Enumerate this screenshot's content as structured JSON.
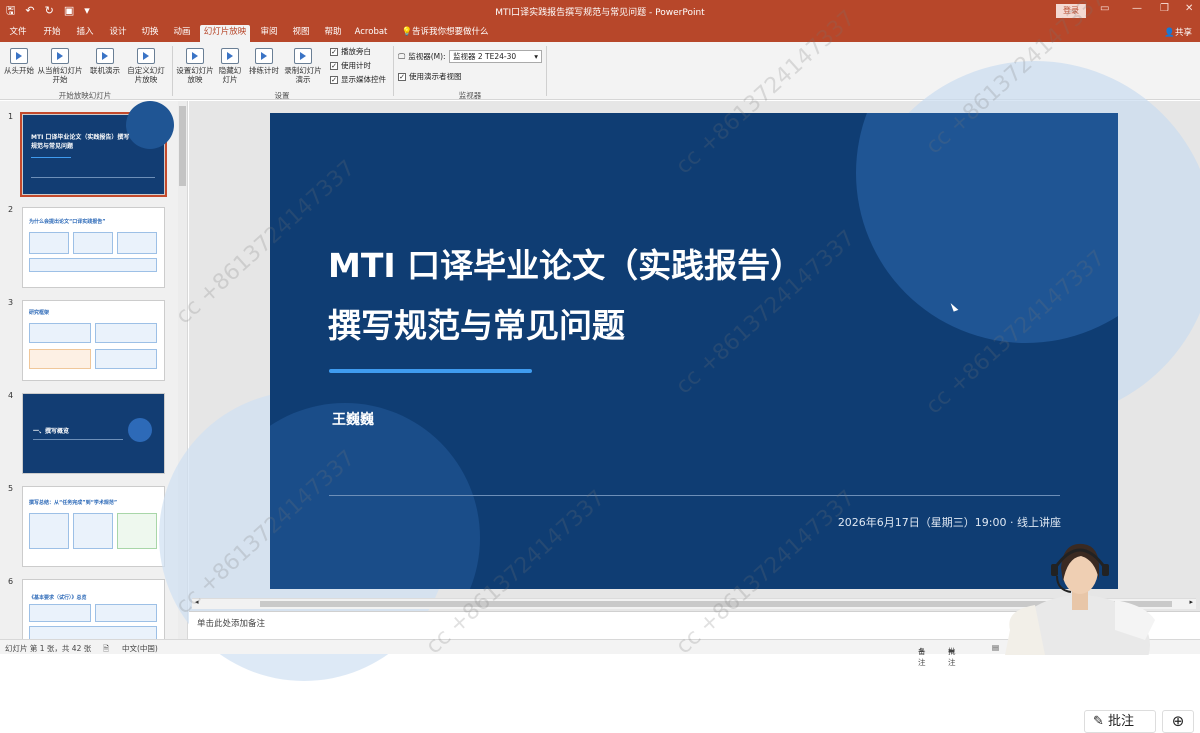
{
  "titlebar": {
    "title": "MTI口译实践报告撰写规范与常见问题 - PowerPoint",
    "login": "登录",
    "colors": {
      "bar": "#b7472a"
    }
  },
  "tabs": [
    "文件",
    "开始",
    "插入",
    "设计",
    "切换",
    "动画",
    "幻灯片放映",
    "审阅",
    "视图",
    "帮助",
    "Acrobat"
  ],
  "active_tab": "幻灯片放映",
  "tell_me": "告诉我你想要做什么",
  "share": "共享",
  "ribbon": {
    "btn_from_start": "从头开始",
    "btn_from_current": "从当前幻灯片开始",
    "btn_online": "联机演示",
    "btn_custom": "自定义幻灯片放映",
    "group_start": "开始放映幻灯片",
    "btn_setup": "设置幻灯片放映",
    "btn_hide": "隐藏幻灯片",
    "btn_rehearse": "排练计时",
    "btn_record": "录制幻灯片演示",
    "chk_narration": "播放旁白",
    "chk_timing": "使用计时",
    "chk_media": "显示媒体控件",
    "group_setup": "设置",
    "monitor_label": "监视器(M):",
    "monitor_value": "监视器 2  TE24-30",
    "chk_presenter": "使用演示者视图",
    "group_monitor": "监视器"
  },
  "thumbnails": {
    "numbers": [
      "1",
      "2",
      "3",
      "4",
      "5",
      "6"
    ],
    "t1_title": "MTI 口译毕业论文（实践报告）撰写规范与常见问题",
    "t2_title": "为什么会提出论文“口译实践报告”",
    "t3_title": "研究框架",
    "t4_title": "一、撰写概览",
    "t5_title": "撰写总结：从“任务完成”到“学术规范”",
    "t6_title": "《基本要求（试行）》总览"
  },
  "slide": {
    "title_line1": "MTI 口译毕业论文（实践报告）",
    "title_line2": "撰写规范与常见问题",
    "author": "王巍巍",
    "date_line": "2026年6月17日（星期三）19:00  ·  线上讲座",
    "colors": {
      "bg": "#0f3d73",
      "accent": "#3f9cf0"
    }
  },
  "notes_placeholder": "单击此处添加备注",
  "status": {
    "slide_count": "幻灯片 第 1 张，共 42 张",
    "language": "中文(中国)",
    "notes": "备注",
    "comments": "批注"
  },
  "floating": {
    "comment_btn": "批注",
    "zoom_icon": "zoom-in-icon"
  },
  "watermark": "cc +8613724147337"
}
